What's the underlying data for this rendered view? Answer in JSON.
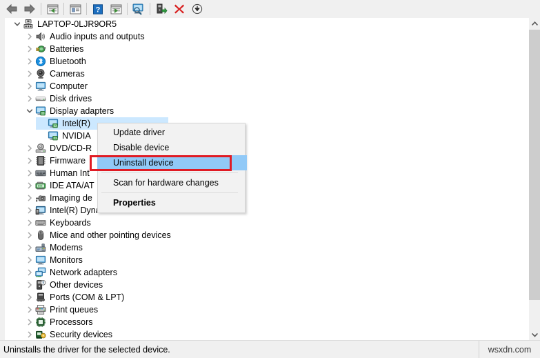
{
  "toolbar": {
    "buttons": [
      {
        "name": "back-button",
        "icon": "back-arrow-icon",
        "title": "Back"
      },
      {
        "name": "forward-button",
        "icon": "forward-arrow-icon",
        "title": "Forward"
      },
      {
        "name": "up-one-level-button",
        "icon": "up-level-icon",
        "title": "Up one level"
      },
      {
        "name": "properties-button",
        "icon": "properties-window-icon",
        "title": "Properties"
      },
      {
        "name": "help-button",
        "icon": "help-question-icon",
        "title": "Help"
      },
      {
        "name": "show-hide-console-tree-button",
        "icon": "console-tree-icon",
        "title": "Show/Hide console tree"
      },
      {
        "name": "scan-for-hardware-changes-button",
        "icon": "scan-monitor-icon",
        "title": "Scan for hardware changes"
      },
      {
        "name": "update-driver-button",
        "icon": "update-driver-icon",
        "title": "Update driver"
      },
      {
        "name": "uninstall-device-button",
        "icon": "red-x-icon",
        "title": "Uninstall device"
      },
      {
        "name": "disable-device-button",
        "icon": "down-arrow-circle-icon",
        "title": "Disable device"
      }
    ]
  },
  "tree": {
    "root": {
      "label": "LAPTOP-0LJR9OR5",
      "icon": "computer-node-icon",
      "expanded": true,
      "indent": 0
    },
    "items": [
      {
        "label": "Audio inputs and outputs",
        "icon": "speaker-icon",
        "expanded": false,
        "indent": 1
      },
      {
        "label": "Batteries",
        "icon": "battery-icon",
        "expanded": false,
        "indent": 1
      },
      {
        "label": "Bluetooth",
        "icon": "bluetooth-icon",
        "expanded": false,
        "indent": 1
      },
      {
        "label": "Cameras",
        "icon": "camera-icon",
        "expanded": false,
        "indent": 1
      },
      {
        "label": "Computer",
        "icon": "monitor-icon",
        "expanded": false,
        "indent": 1
      },
      {
        "label": "Disk drives",
        "icon": "disk-drive-icon",
        "expanded": false,
        "indent": 1
      },
      {
        "label": "Display adapters",
        "icon": "display-adapter-icon",
        "expanded": true,
        "indent": 1
      },
      {
        "label": "Intel(R)",
        "icon": "display-adapter-icon",
        "expanded": null,
        "indent": 2,
        "selected": true
      },
      {
        "label": "NVIDIA",
        "icon": "display-adapter-icon",
        "expanded": null,
        "indent": 2
      },
      {
        "label": "DVD/CD-R",
        "icon": "dvd-drive-icon",
        "expanded": false,
        "indent": 1
      },
      {
        "label": "Firmware",
        "icon": "firmware-chip-icon",
        "expanded": false,
        "indent": 1
      },
      {
        "label": "Human Int",
        "icon": "hid-keyboard-icon",
        "expanded": false,
        "indent": 1
      },
      {
        "label": "IDE ATA/AT",
        "icon": "ide-controller-icon",
        "expanded": false,
        "indent": 1
      },
      {
        "label": "Imaging de",
        "icon": "imaging-device-icon",
        "expanded": false,
        "indent": 1
      },
      {
        "label": "Intel(R) Dynamic Platform and Thermal Framework",
        "icon": "thermal-framework-icon",
        "expanded": false,
        "indent": 1
      },
      {
        "label": "Keyboards",
        "icon": "keyboard-icon",
        "expanded": false,
        "indent": 1
      },
      {
        "label": "Mice and other pointing devices",
        "icon": "mouse-icon",
        "expanded": false,
        "indent": 1
      },
      {
        "label": "Modems",
        "icon": "modem-icon",
        "expanded": false,
        "indent": 1
      },
      {
        "label": "Monitors",
        "icon": "monitor-icon",
        "expanded": false,
        "indent": 1
      },
      {
        "label": "Network adapters",
        "icon": "network-adapter-icon",
        "expanded": false,
        "indent": 1
      },
      {
        "label": "Other devices",
        "icon": "other-device-icon",
        "expanded": false,
        "indent": 1
      },
      {
        "label": "Ports (COM & LPT)",
        "icon": "port-icon",
        "expanded": false,
        "indent": 1
      },
      {
        "label": "Print queues",
        "icon": "printer-icon",
        "expanded": false,
        "indent": 1
      },
      {
        "label": "Processors",
        "icon": "processor-icon",
        "expanded": false,
        "indent": 1
      },
      {
        "label": "Security devices",
        "icon": "security-device-icon",
        "expanded": false,
        "indent": 1
      }
    ]
  },
  "context_menu": {
    "items": [
      {
        "label": "Update driver",
        "name": "menu-item-update-driver",
        "bold": false,
        "highlighted": false
      },
      {
        "label": "Disable device",
        "name": "menu-item-disable-device",
        "bold": false,
        "highlighted": false
      },
      {
        "label": "Uninstall device",
        "name": "menu-item-uninstall-device",
        "bold": false,
        "highlighted": true
      },
      {
        "label": "Scan for hardware changes",
        "name": "menu-item-scan-for-hardware-changes",
        "bold": false,
        "highlighted": false
      },
      {
        "label": "Properties",
        "name": "menu-item-properties",
        "bold": true,
        "highlighted": false
      }
    ]
  },
  "status_bar": {
    "text": "Uninstalls the driver for the selected device.",
    "watermark": "wsxdn.com"
  },
  "colors": {
    "selection_blue": "#cce8ff",
    "menu_highlight_blue": "#91c9f7",
    "annotation_red": "#e01b24",
    "chrome_gray": "#f0f0f0",
    "scrollbar_thumb": "#cdcdcd"
  }
}
